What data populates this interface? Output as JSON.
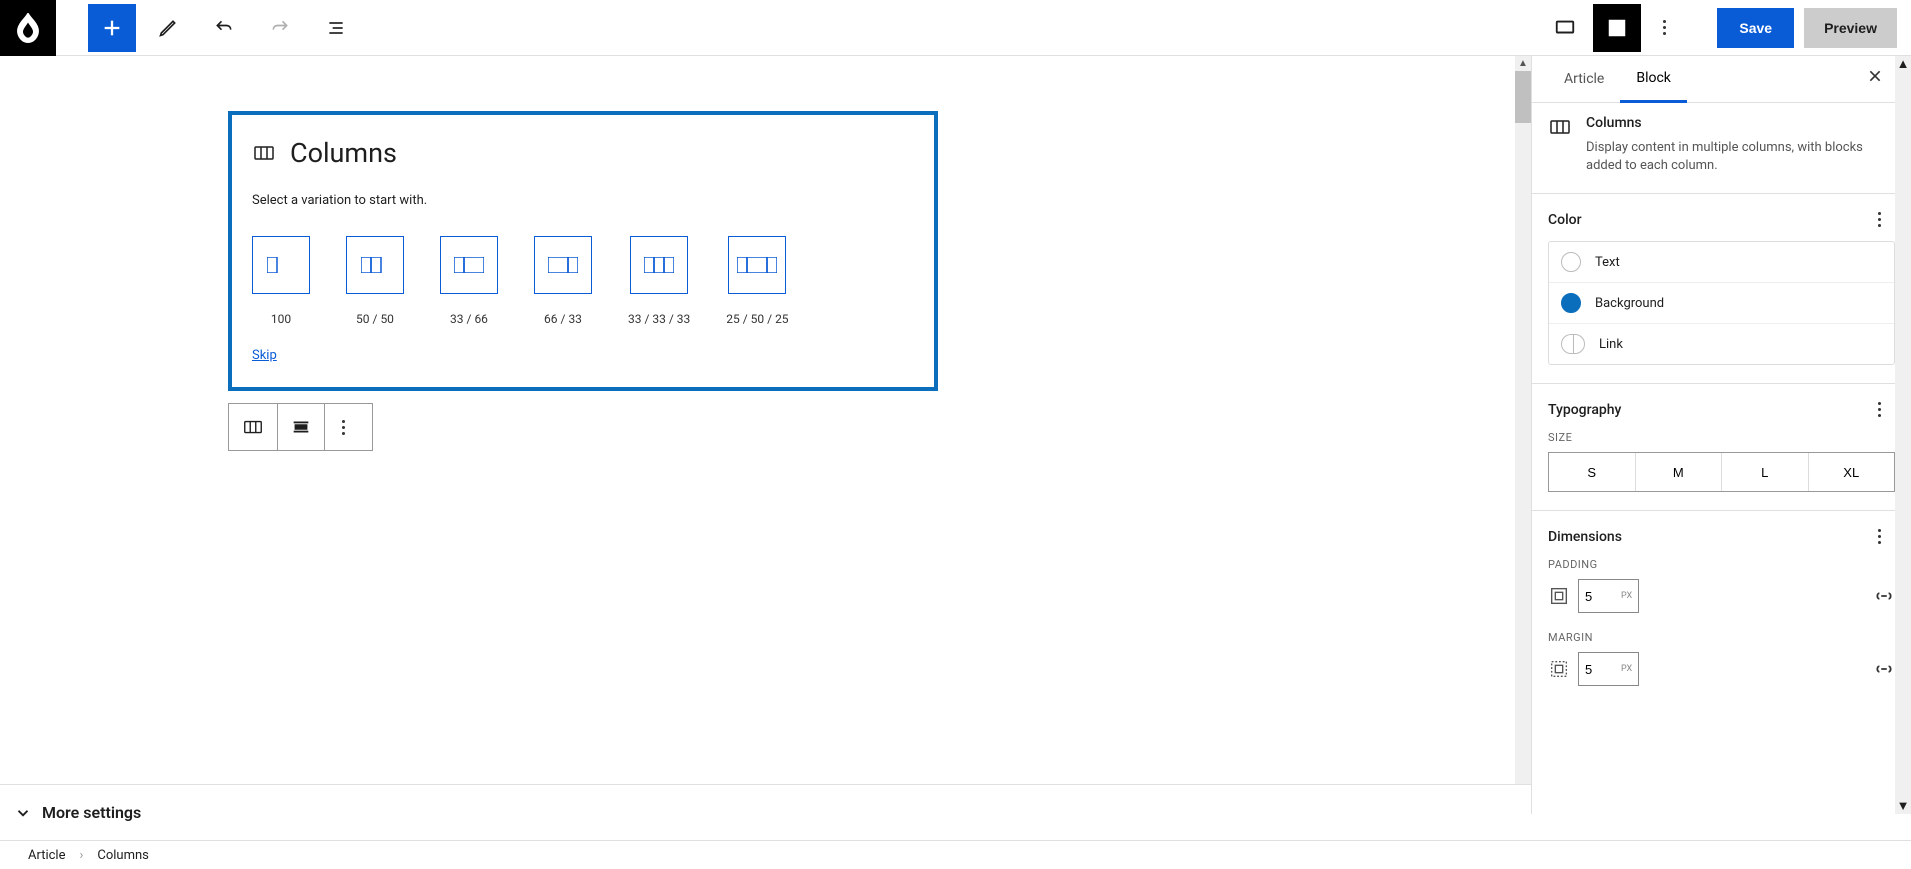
{
  "toolbar": {
    "save": "Save",
    "preview": "Preview"
  },
  "block": {
    "title": "Columns",
    "subtitle": "Select a variation to start with.",
    "variations": [
      {
        "label": "100",
        "cols": [
          1
        ]
      },
      {
        "label": "50 / 50",
        "cols": [
          1,
          1
        ]
      },
      {
        "label": "33 / 66",
        "cols": [
          1,
          2
        ]
      },
      {
        "label": "66 / 33",
        "cols": [
          2,
          1
        ]
      },
      {
        "label": "33 / 33 / 33",
        "cols": [
          1,
          1,
          1
        ]
      },
      {
        "label": "25 / 50 / 25",
        "cols": [
          1,
          2,
          1
        ]
      }
    ],
    "skip": "Skip"
  },
  "sidebar": {
    "tabs": {
      "article": "Article",
      "block": "Block"
    },
    "block_name": "Columns",
    "block_desc": "Display content in multiple columns, with blocks added to each column.",
    "color": {
      "title": "Color",
      "text": "Text",
      "background": "Background",
      "link": "Link",
      "bg_value": "#0a6ebc"
    },
    "typography": {
      "title": "Typography",
      "size_label": "SIZE",
      "sizes": [
        "S",
        "M",
        "L",
        "XL"
      ]
    },
    "dimensions": {
      "title": "Dimensions",
      "padding_label": "PADDING",
      "padding_value": "5",
      "padding_unit": "PX",
      "margin_label": "MARGIN",
      "margin_value": "5",
      "margin_unit": "PX"
    }
  },
  "more_settings": "More settings",
  "breadcrumb": {
    "root": "Article",
    "current": "Columns"
  }
}
